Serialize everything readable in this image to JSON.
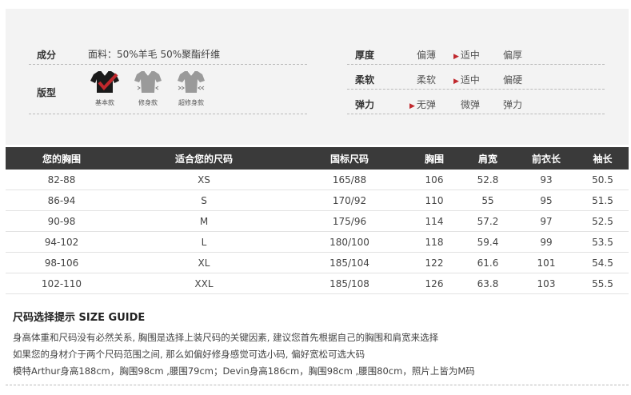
{
  "composition": {
    "label": "成分",
    "value": "面料：50%羊毛 50%聚酯纤维"
  },
  "fit": {
    "label": "版型",
    "options": [
      {
        "caption": "基本款",
        "icon": "shirt-black-checked-icon",
        "selected": true
      },
      {
        "caption": "修身款",
        "icon": "shirt-gray-fitted-icon",
        "selected": false
      },
      {
        "caption": "超修身款",
        "icon": "shirt-gray-slim-icon",
        "selected": false
      }
    ]
  },
  "attributes": [
    {
      "label": "厚度",
      "options": [
        "偏薄",
        "适中",
        "偏厚"
      ],
      "selected_index": 1
    },
    {
      "label": "柔软",
      "options": [
        "柔软",
        "适中",
        "偏硬"
      ],
      "selected_index": 1
    },
    {
      "label": "弹力",
      "options": [
        "无弹",
        "微弹",
        "弹力"
      ],
      "selected_index": 0
    }
  ],
  "colors": {
    "accent": "#c0282d",
    "header_bg": "#3a3a3a",
    "panel_bg": "#f3f3f3"
  },
  "size_table": {
    "headers": [
      "您的胸围",
      "适合您的尺码",
      "国标尺码",
      "胸围",
      "肩宽",
      "前衣长",
      "袖长"
    ],
    "rows": [
      [
        "82-88",
        "XS",
        "165/88",
        "106",
        "52.8",
        "93",
        "50.5"
      ],
      [
        "86-94",
        "S",
        "170/92",
        "110",
        "55",
        "95",
        "51.5"
      ],
      [
        "90-98",
        "M",
        "175/96",
        "114",
        "57.2",
        "97",
        "52.5"
      ],
      [
        "94-102",
        "L",
        "180/100",
        "118",
        "59.4",
        "99",
        "53.5"
      ],
      [
        "98-106",
        "XL",
        "185/104",
        "122",
        "61.6",
        "101",
        "54.5"
      ],
      [
        "102-110",
        "XXL",
        "185/108",
        "126",
        "63.8",
        "103",
        "55.5"
      ]
    ]
  },
  "guide": {
    "title": "尺码选择提示 SIZE GUIDE",
    "lines": [
      "身高体重和尺码没有必然关系, 胸围是选择上装尺码的关键因素, 建议您首先根据自己的胸围和肩宽来选择",
      "如果您的身材介于两个尺码范围之间, 那么如偏好修身感觉可选小码, 偏好宽松可选大码",
      "模特Arthur身高188cm，胸围98cm ,腰围79cm；Devin身高186cm，胸围98cm ,腰围80cm，照片上皆为M码"
    ]
  }
}
